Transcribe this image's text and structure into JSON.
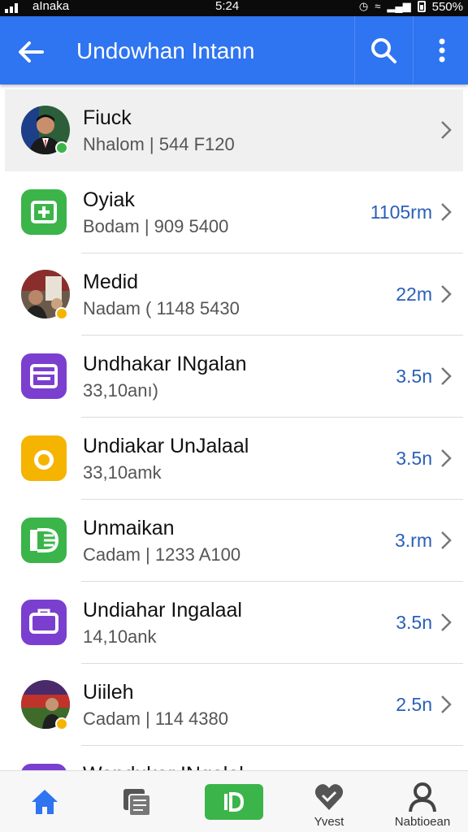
{
  "status_bar": {
    "carrier": "aInaka",
    "time": "5:24",
    "battery": "550%"
  },
  "app_bar": {
    "title": "Undowhan Intann",
    "icons": [
      "back-arrow-icon",
      "search-icon",
      "more-vert-icon"
    ]
  },
  "list": {
    "items": [
      {
        "name": "Fiuck",
        "subtitle": "Nhalom | 544 F120",
        "meta": "",
        "icon": "avatar-photo",
        "selected": true
      },
      {
        "name": "Oyiak",
        "subtitle": "Bodam | 909 5400",
        "meta": "1105rm",
        "icon": "green-chat-icon"
      },
      {
        "name": "Medid",
        "subtitle": "Nadam ( 1148 5430",
        "meta": "22m",
        "icon": "avatar-photo"
      },
      {
        "name": "Undhakar INgalan",
        "subtitle": "33,10anı)",
        "meta": "3.5n",
        "icon": "purple-calendar-icon"
      },
      {
        "name": "Undiakar UnJalaal",
        "subtitle": "33,10amk",
        "meta": "3.5n",
        "icon": "yellow-circle-icon"
      },
      {
        "name": "Unmaikan",
        "subtitle": "Cadam | 1233 A100",
        "meta": "3.rm",
        "icon": "green-folder-icon"
      },
      {
        "name": "Undiahar Ingalaal",
        "subtitle": "14,10ank",
        "meta": "3.5n",
        "icon": "purple-bag-icon"
      },
      {
        "name": "Uiileh",
        "subtitle": "Cadam | 114 4380",
        "meta": "2.5n",
        "icon": "avatar-photo"
      },
      {
        "name": "Wandukar INgalal",
        "subtitle": "",
        "meta": "",
        "icon": "purple-folder-icon"
      }
    ]
  },
  "bottom_nav": {
    "items": [
      {
        "label": "",
        "icon": "home-icon",
        "active": true
      },
      {
        "label": "",
        "icon": "stack-icon"
      },
      {
        "label": "",
        "icon": "green-id-icon"
      },
      {
        "label": "Yvest",
        "icon": "heart-icon"
      },
      {
        "label": "Nabtioean",
        "icon": "person-icon"
      }
    ]
  },
  "colors": {
    "app_bar": "#2f74f0",
    "meta_text": "#2a5fb8",
    "active_nav": "#2f74f0",
    "green": "#3bb54a",
    "purple": "#7b3fd0",
    "yellow": "#f5b400"
  }
}
